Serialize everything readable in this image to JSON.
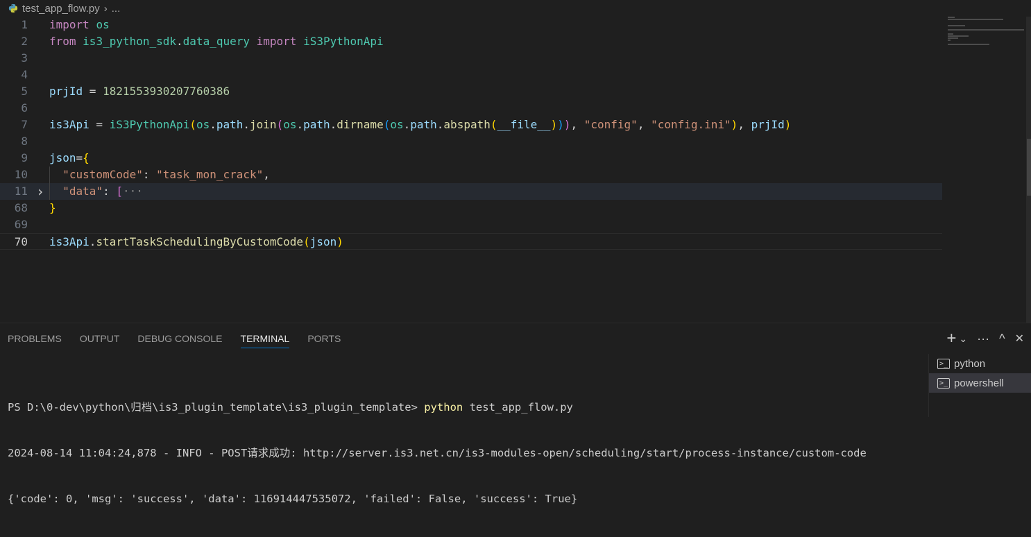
{
  "breadcrumb": {
    "file": "test_app_flow.py",
    "more": "..."
  },
  "editor": {
    "lines": [
      {
        "n": "1",
        "t": [
          [
            "kw",
            "import"
          ],
          [
            "plain",
            " "
          ],
          [
            "mod",
            "os"
          ]
        ]
      },
      {
        "n": "2",
        "t": [
          [
            "kw",
            "from"
          ],
          [
            "plain",
            " "
          ],
          [
            "mod",
            "is3_python_sdk"
          ],
          [
            "plain",
            "."
          ],
          [
            "mod",
            "data_query"
          ],
          [
            "plain",
            " "
          ],
          [
            "kw",
            "import"
          ],
          [
            "plain",
            " "
          ],
          [
            "mod",
            "iS3PythonApi"
          ]
        ]
      },
      {
        "n": "3",
        "t": []
      },
      {
        "n": "4",
        "t": []
      },
      {
        "n": "5",
        "t": [
          [
            "var",
            "prjId"
          ],
          [
            "plain",
            " = "
          ],
          [
            "num",
            "1821553930207760386"
          ]
        ]
      },
      {
        "n": "6",
        "t": []
      },
      {
        "n": "7",
        "t": [
          [
            "var",
            "is3Api"
          ],
          [
            "plain",
            " = "
          ],
          [
            "mod",
            "iS3PythonApi"
          ],
          [
            "br1",
            "("
          ],
          [
            "mod",
            "os"
          ],
          [
            "plain",
            "."
          ],
          [
            "var",
            "path"
          ],
          [
            "plain",
            "."
          ],
          [
            "fn",
            "join"
          ],
          [
            "br2",
            "("
          ],
          [
            "mod",
            "os"
          ],
          [
            "plain",
            "."
          ],
          [
            "var",
            "path"
          ],
          [
            "plain",
            "."
          ],
          [
            "fn",
            "dirname"
          ],
          [
            "br3",
            "("
          ],
          [
            "mod",
            "os"
          ],
          [
            "plain",
            "."
          ],
          [
            "var",
            "path"
          ],
          [
            "plain",
            "."
          ],
          [
            "fn",
            "abspath"
          ],
          [
            "br1",
            "("
          ],
          [
            "var",
            "__file__"
          ],
          [
            "br1",
            ")"
          ],
          [
            "br3",
            ")"
          ],
          [
            "br2",
            ")"
          ],
          [
            "plain",
            ", "
          ],
          [
            "str",
            "\"config\""
          ],
          [
            "plain",
            ", "
          ],
          [
            "str",
            "\"config.ini\""
          ],
          [
            "br1",
            ")"
          ],
          [
            "plain",
            ", "
          ],
          [
            "var",
            "prjId"
          ],
          [
            "br1",
            ")"
          ]
        ]
      },
      {
        "n": "8",
        "t": []
      },
      {
        "n": "9",
        "t": [
          [
            "var",
            "json"
          ],
          [
            "plain",
            "="
          ],
          [
            "br1",
            "{"
          ]
        ]
      },
      {
        "n": "10",
        "t": [
          [
            "plain",
            "  "
          ],
          [
            "str",
            "\"customCode\""
          ],
          [
            "plain",
            ": "
          ],
          [
            "str",
            "\"task_mon_crack\""
          ],
          [
            "plain",
            ","
          ]
        ]
      },
      {
        "n": "11",
        "t": [
          [
            "plain",
            "  "
          ],
          [
            "str",
            "\"data\""
          ],
          [
            "plain",
            ": "
          ],
          [
            "br2",
            "["
          ],
          [
            "ellipsis",
            "···"
          ]
        ]
      },
      {
        "n": "68",
        "t": [
          [
            "br1",
            "}"
          ]
        ]
      },
      {
        "n": "69",
        "t": []
      },
      {
        "n": "70",
        "t": [
          [
            "var",
            "is3Api"
          ],
          [
            "plain",
            "."
          ],
          [
            "fn",
            "startTaskSchedulingByCustomCode"
          ],
          [
            "br1",
            "("
          ],
          [
            "var",
            "json"
          ],
          [
            "br1",
            ")"
          ]
        ]
      }
    ]
  },
  "panel": {
    "tabs": [
      "PROBLEMS",
      "OUTPUT",
      "DEBUG CONSOLE",
      "TERMINAL",
      "PORTS"
    ],
    "active_tab": "TERMINAL",
    "actions": {
      "add": "+",
      "dropdown": "⌄",
      "more": "···",
      "maximize": "^",
      "close": "✕"
    }
  },
  "terminal": {
    "prompt": "PS D:\\0-dev\\python\\归档\\is3_plugin_template\\is3_plugin_template> ",
    "command": "python",
    "command_arg": " test_app_flow.py",
    "line2": "2024-08-14 11:04:24,878 - INFO - POST请求成功: http://server.is3.net.cn/is3-modules-open/scheduling/start/process-instance/custom-code",
    "line3": "{'code': 0, 'msg': 'success', 'data': 116914447535072, 'failed': False, 'success': True}",
    "sessions": [
      {
        "name": "python",
        "selected": false
      },
      {
        "name": "powershell",
        "selected": true
      }
    ]
  },
  "colors": {
    "accent": "#0078d4",
    "background": "#1f1f1f"
  }
}
